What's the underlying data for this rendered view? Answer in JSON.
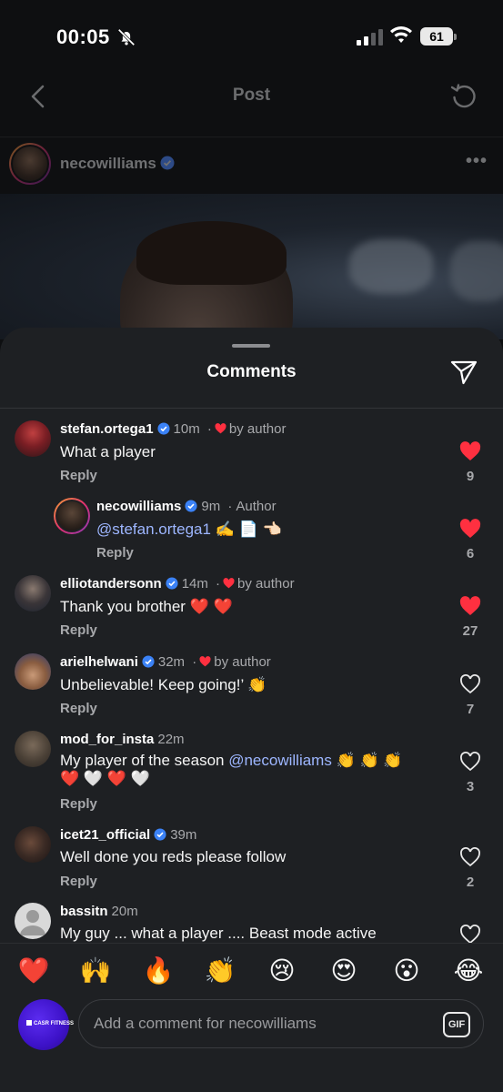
{
  "status_bar": {
    "time": "00:05",
    "battery": "61"
  },
  "nav": {
    "title": "Post"
  },
  "post": {
    "username": "necowilliams",
    "more": "•••"
  },
  "sheet": {
    "title": "Comments"
  },
  "comments": [
    {
      "username": "stefan.ortega1",
      "verified": true,
      "time": "10m",
      "liked_by_author": true,
      "by_author_label": "by author",
      "text": "What a player",
      "reply": "Reply",
      "likes": "9",
      "liked": true
    },
    {
      "username": "necowilliams",
      "verified": true,
      "time": "9m",
      "author_label": "Author",
      "mention": "@stefan.ortega1",
      "text": " ✍️ 📄 👈🏻",
      "reply": "Reply",
      "likes": "6",
      "liked": true
    },
    {
      "username": "elliotandersonn",
      "verified": true,
      "time": "14m",
      "liked_by_author": true,
      "by_author_label": "by author",
      "text": "Thank you brother ❤️ ❤️",
      "reply": "Reply",
      "likes": "27",
      "liked": true
    },
    {
      "username": "arielhelwani",
      "verified": true,
      "time": "32m",
      "liked_by_author": true,
      "by_author_label": "by author",
      "text": "Unbelievable! Keep going!’ 👏",
      "reply": "Reply",
      "likes": "7",
      "liked": false
    },
    {
      "username": "mod_for_insta",
      "verified": false,
      "time": "22m",
      "text_before": "My player of the season ",
      "mention": "@necowilliams",
      "text_after": " 👏 👏 👏",
      "text_line2": "❤️ 🤍 ❤️ 🤍",
      "reply": "Reply",
      "likes": "3",
      "liked": false
    },
    {
      "username": "icet21_official",
      "verified": true,
      "time": "39m",
      "text": "Well done you reds please follow",
      "reply": "Reply",
      "likes": "2",
      "liked": false
    },
    {
      "username": "bassitn",
      "verified": false,
      "time": "20m",
      "text": "My guy ... what a player .... Beast mode active",
      "liked": false
    }
  ],
  "reactions": [
    "❤️",
    "🙌",
    "🔥",
    "👏",
    "😢",
    "😍",
    "😮",
    "😂"
  ],
  "composer": {
    "placeholder": "Add a comment for necowilliams",
    "gif_label": "GIF",
    "avatar_brand": "CASR FITNESS"
  },
  "colors": {
    "sheet_bg": "#1e2023",
    "like_red": "#ff3040",
    "mention_blue": "#9db6ff",
    "verified_blue": "#3b82f6"
  }
}
